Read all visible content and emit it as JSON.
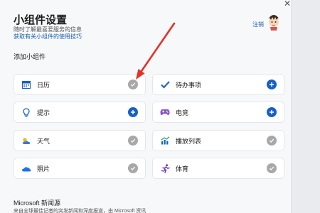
{
  "header": {
    "title": "小组件设置",
    "subtitle": "随时了解最喜爱服务的信息",
    "help_link": "获取有关小组件的使用技巧",
    "signout": "注销",
    "close": "✕"
  },
  "section_label": "添加小组件",
  "widgets": [
    {
      "label": "日历",
      "icon": "calendar-icon",
      "state": "added"
    },
    {
      "label": "待办事项",
      "icon": "todo-check-icon",
      "state": "add"
    },
    {
      "label": "提示",
      "icon": "tips-lightbulb-icon",
      "state": "add"
    },
    {
      "label": "电竞",
      "icon": "gamepad-icon",
      "state": "add"
    },
    {
      "label": "天气",
      "icon": "weather-icon",
      "state": "added"
    },
    {
      "label": "播放列表",
      "icon": "playlist-chart-icon",
      "state": "added"
    },
    {
      "label": "照片",
      "icon": "cloud-photos-icon",
      "state": "added"
    },
    {
      "label": "体育",
      "icon": "sports-runner-icon",
      "state": "added"
    }
  ],
  "news": {
    "title": "Microsoft 新闻源",
    "description": "来自全球最佳记者的突发新闻和深度报道，由 Microsoft 资讯"
  },
  "colors": {
    "accent": "#1560c8",
    "added_state": "#a8a8a8",
    "annotation_arrow": "#e5312b"
  }
}
